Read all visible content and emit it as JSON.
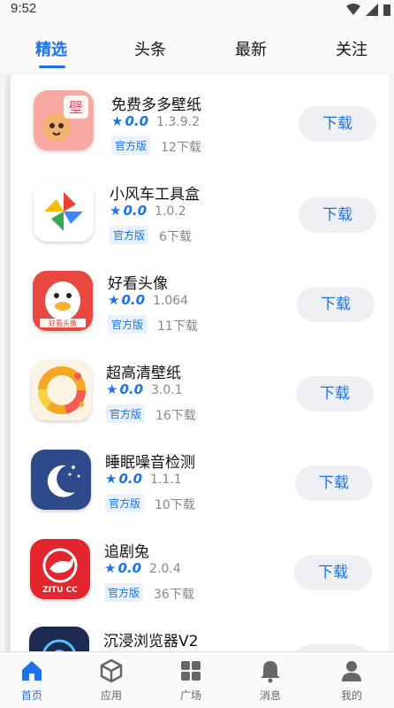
{
  "status_bar": {
    "time": "9:52"
  },
  "tabs": [
    {
      "label": "精选"
    },
    {
      "label": "头条"
    },
    {
      "label": "最新"
    },
    {
      "label": "关注"
    }
  ],
  "apps": [
    {
      "name": "免费多多壁纸",
      "rating": "0.0",
      "version": "1.3.9.2",
      "badge": "官方版",
      "downloads": "12下载",
      "button": "下载",
      "icon": "cartoon-animal-wallpaper-icon"
    },
    {
      "name": "小风车工具盒",
      "rating": "0.0",
      "version": "1.0.2",
      "badge": "官方版",
      "downloads": "6下载",
      "button": "下载",
      "icon": "pinwheel-icon"
    },
    {
      "name": "好看头像",
      "rating": "0.0",
      "version": "1.064",
      "badge": "官方版",
      "downloads": "11下载",
      "button": "下载",
      "icon": "duck-avatar-icon"
    },
    {
      "name": "超高清壁纸",
      "rating": "0.0",
      "version": "3.0.1",
      "badge": "官方版",
      "downloads": "16下载",
      "button": "下载",
      "icon": "colorful-ring-icon"
    },
    {
      "name": "睡眠噪音检测",
      "rating": "0.0",
      "version": "1.1.1",
      "badge": "官方版",
      "downloads": "10下载",
      "button": "下载",
      "icon": "moon-stars-icon"
    },
    {
      "name": "追剧兔",
      "rating": "0.0",
      "version": "2.0.4",
      "badge": "官方版",
      "downloads": "36下载",
      "button": "下载",
      "icon": "rabbit-icon"
    },
    {
      "name": "沉浸浏览器V2",
      "rating": "",
      "version": "",
      "badge": "",
      "downloads": "",
      "button": "",
      "icon": "browser-icon"
    }
  ],
  "bottom_nav": [
    {
      "label": "首页",
      "icon": "home-icon"
    },
    {
      "label": "应用",
      "icon": "box-icon"
    },
    {
      "label": "广场",
      "icon": "grid-icon"
    },
    {
      "label": "消息",
      "icon": "bell-icon"
    },
    {
      "label": "我的",
      "icon": "user-icon"
    }
  ],
  "colors": {
    "accent": "#1a73e8",
    "button_bg": "#eef0f3",
    "badge_bg": "#e8f1fd"
  }
}
